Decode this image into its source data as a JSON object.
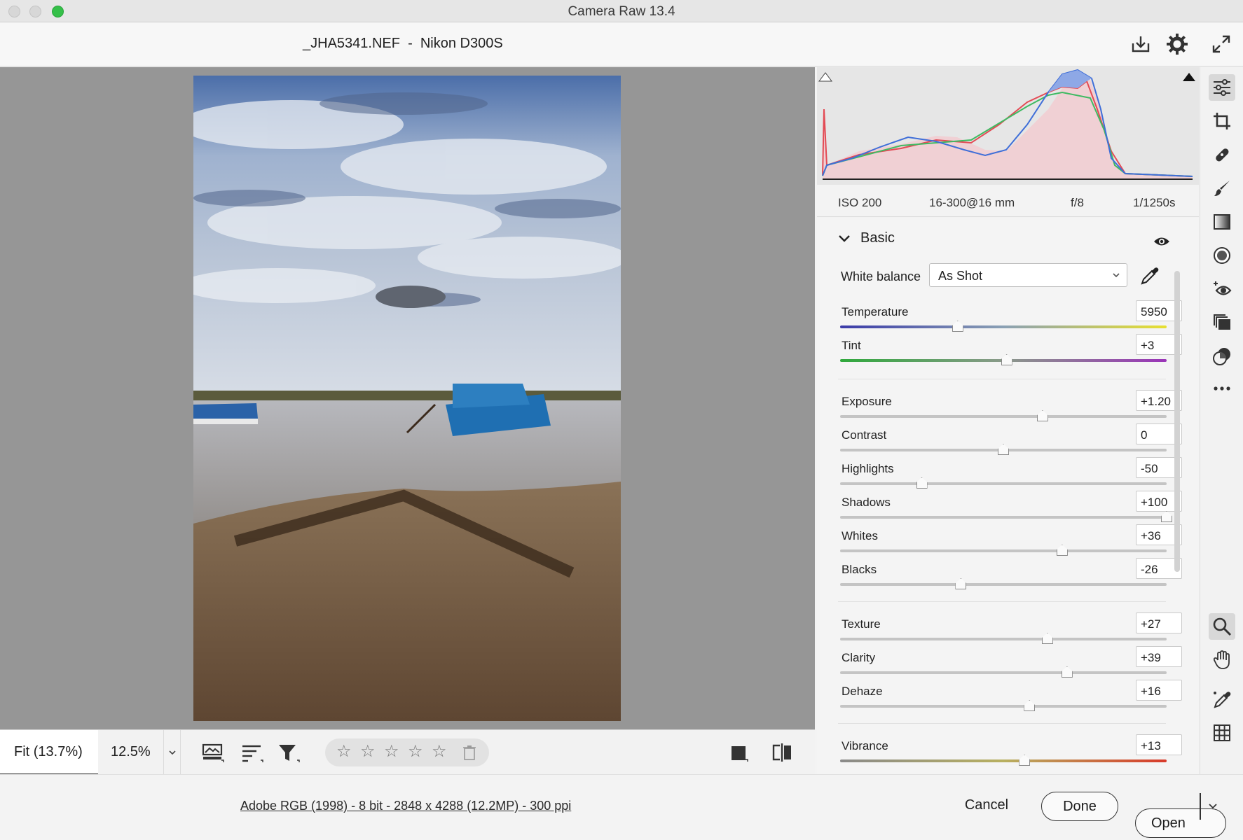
{
  "window": {
    "title": "Camera Raw 13.4"
  },
  "header": {
    "file_title": "_JHA5341.NEF  -  Nikon D300S"
  },
  "exif": {
    "iso": "ISO 200",
    "lens": "16-300@16 mm",
    "aperture": "f/8",
    "shutter": "1/1250s"
  },
  "basic": {
    "section_title": "Basic",
    "white_balance_label": "White balance",
    "white_balance_value": "As Shot",
    "sliders": [
      {
        "label": "Temperature",
        "value": "5950",
        "position": 0.36
      },
      {
        "label": "Tint",
        "value": "+3",
        "position": 0.51
      },
      {
        "label": "Exposure",
        "value": "+1.20",
        "position": 0.62
      },
      {
        "label": "Contrast",
        "value": "0",
        "position": 0.5
      },
      {
        "label": "Highlights",
        "value": "-50",
        "position": 0.25
      },
      {
        "label": "Shadows",
        "value": "+100",
        "position": 1.0
      },
      {
        "label": "Whites",
        "value": "+36",
        "position": 0.68
      },
      {
        "label": "Blacks",
        "value": "-26",
        "position": 0.37
      },
      {
        "label": "Texture",
        "value": "+27",
        "position": 0.635
      },
      {
        "label": "Clarity",
        "value": "+39",
        "position": 0.695
      },
      {
        "label": "Dehaze",
        "value": "+16",
        "position": 0.58
      },
      {
        "label": "Vibrance",
        "value": "+13",
        "position": 0.565
      }
    ]
  },
  "toolbar": {
    "zoom_fit": "Fit (13.7%)",
    "zoom_percent": "12.5%"
  },
  "footer": {
    "image_info": "Adobe RGB (1998) - 8 bit - 2848 x 4288 (12.2MP) - 300 ppi",
    "cancel_label": "Cancel",
    "done_label": "Done",
    "open_label": "Open"
  },
  "colors": {
    "accent_temp_start": "#3a3aa8",
    "accent_temp_end": "#e8e030",
    "tint_start": "#2fa83c",
    "tint_end": "#9a34b8"
  }
}
